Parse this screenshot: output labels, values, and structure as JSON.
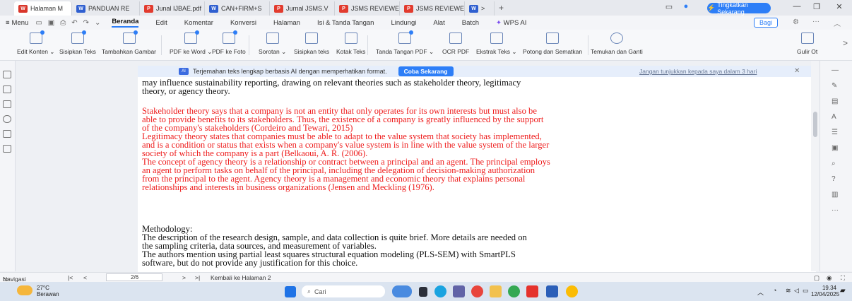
{
  "tabs": [
    {
      "label": "Halaman M",
      "icon": "wps"
    },
    {
      "label": "PANDUAN RE",
      "icon": "w"
    },
    {
      "label": "Junal IJBAE.pdf",
      "icon": "pdf"
    },
    {
      "label": "CAN+FIRM+S",
      "icon": "w"
    },
    {
      "label": "Jurnal JSMS.V",
      "icon": "pdf"
    },
    {
      "label": "JSMS REVIEWE",
      "icon": "pdf"
    },
    {
      "label": "JSMS REVIEWE",
      "icon": "pdf"
    },
    {
      "label": ">",
      "icon": "w"
    }
  ],
  "new_tab": "+",
  "upgrade_label": "Tingkatkan Sekarang",
  "menu": {
    "menu_label": "Menu",
    "items": [
      "Beranda",
      "Edit",
      "Komentar",
      "Konversi",
      "Halaman",
      "Isi & Tanda Tangan",
      "Lindungi",
      "Alat",
      "Batch"
    ],
    "ai_label": "WPS AI",
    "share_label": "Bagi"
  },
  "ribbon": [
    "Edit Konten ⌄",
    "Sisipkan Teks",
    "Tambahkan Gambar",
    "PDF ke Word ⌄",
    "PDF ke Foto",
    "Sorotan ⌄",
    "Sisipkan teks",
    "Kotak Teks",
    "Tanda Tangan PDF ⌄",
    "OCR PDF",
    "Ekstrak Teks ⌄",
    "Potong dan Sematkan",
    "Temukan dan Ganti",
    "Gulir Ot"
  ],
  "notification": {
    "text": "Terjemahan teks lengkap berbasis AI dengan memperhatikan format.",
    "button": "Coba Sekarang",
    "dismiss": "Jangan tunjukkan kepada saya dalam 3 hari"
  },
  "document": {
    "lines_top": [
      "may influence sustainability reporting, drawing on relevant theories such as stakeholder theory, legitimacy",
      "theory, or agency theory."
    ],
    "lines_red": [
      "Stakeholder theory says that a company is not an entity that only operates for its own interests but must also be",
      "able to provide benefits to its stakeholders. Thus, the existence of a company is greatly influenced by the support",
      "of the company's stakeholders (Cordeiro and Tewari, 2015)",
      "Legitimacy theory states that companies must be able to adapt to the value system that society has implemented,",
      "and is a condition or status that exists when a company's value system is in line with the value system of the larger",
      "society of which the company is a part (Belkaoui, A. R. (2006).",
      "The concept of agency theory is a relationship or contract between a principal and an agent. The principal employs",
      "an agent to perform tasks on behalf of the principal, including the delegation of decision-making authorization",
      "from the principal to the agent. Agency theory is a management and economic theory that explains personal",
      "relationships and interests in business organizations (Jensen and Meckling (1976)."
    ],
    "lines_bottom": [
      "Methodology:",
      "The description of the research design, sample, and data collection is quite brief. More details are needed on",
      "the sampling criteria, data sources, and measurement of variables.",
      "The authors mention using partial least squares structural equation modeling (PLS-SEM) with SmartPLS",
      "software, but do not provide any justification for this choice."
    ]
  },
  "status": {
    "nav_label": "Navigasi",
    "page": "2/6",
    "back_label": "Kembali ke Halaman 2"
  },
  "taskbar": {
    "temperature": "27°C",
    "weather": "Berawan",
    "search_placeholder": "Cari",
    "time": "19.34",
    "date": "12/04/2025"
  },
  "colors": {
    "accent": "#2d7ef7",
    "red_text": "#ee1c1c"
  }
}
